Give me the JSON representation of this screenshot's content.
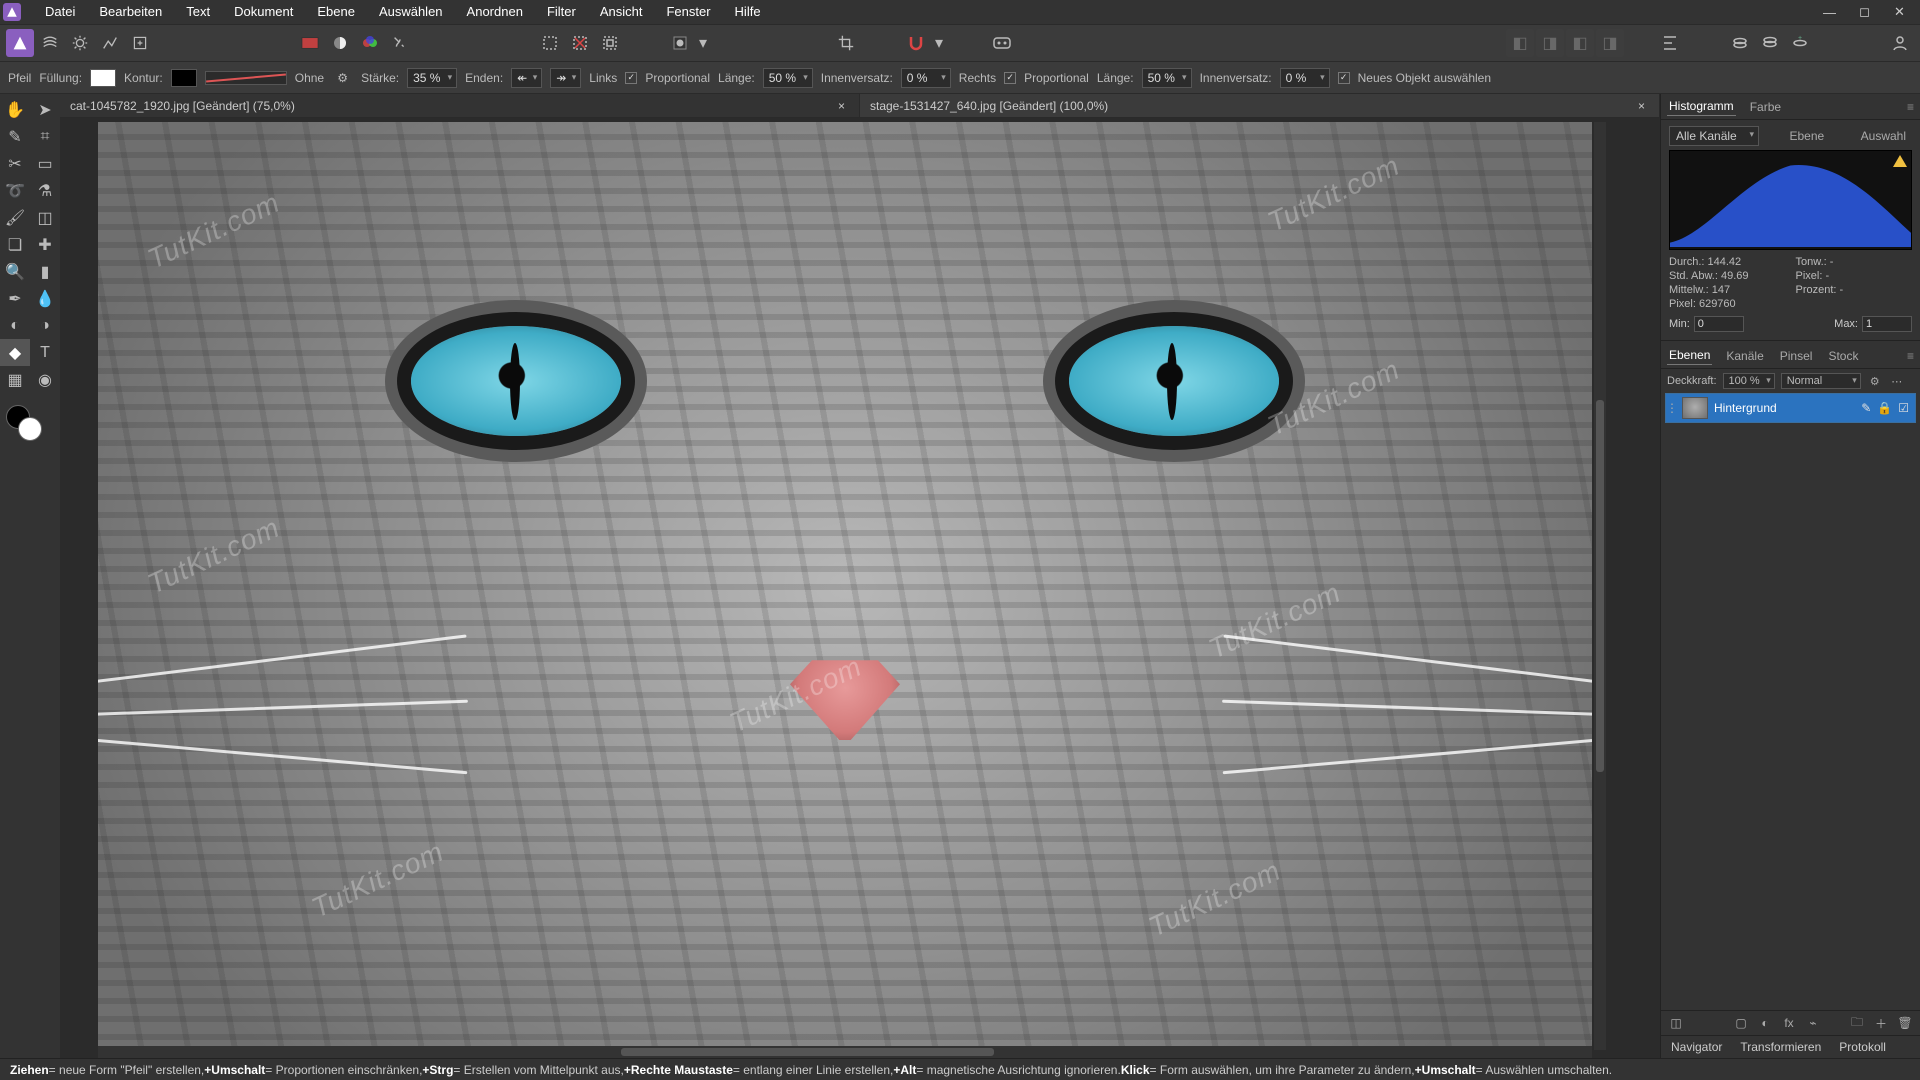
{
  "menu": [
    "Datei",
    "Bearbeiten",
    "Text",
    "Dokument",
    "Ebene",
    "Auswählen",
    "Anordnen",
    "Filter",
    "Ansicht",
    "Fenster",
    "Hilfe"
  ],
  "context": {
    "tool": "Pfeil",
    "fill_label": "Füllung:",
    "fill_color": "#ffffff",
    "stroke_label": "Kontur:",
    "stroke_color": "#000000",
    "style_label": "Ohne",
    "strength_label": "Stärke:",
    "strength_value": "35 %",
    "ends_label": "Enden:",
    "links_label": "Links",
    "proportional_label": "Proportional",
    "length_label": "Länge:",
    "length_left": "50 %",
    "inset_label": "Innenversatz:",
    "inset_left": "0 %",
    "rechts_label": "Rechts",
    "length_right": "50 %",
    "inset_right": "0 %",
    "new_obj_label": "Neues Objekt auswählen"
  },
  "tabs": [
    {
      "title": "cat-1045782_1920.jpg [Geändert] (75,0%)",
      "active": true
    },
    {
      "title": "stage-1531427_640.jpg [Geändert] (100,0%)",
      "active": false
    }
  ],
  "watermark": "TutKit.com",
  "right": {
    "tab_hist": "Histogramm",
    "tab_farbe": "Farbe",
    "channel": "Alle Kanäle",
    "btn_ebene": "Ebene",
    "btn_auswahl": "Auswahl",
    "stats": {
      "durch": "Durch.: 144.42",
      "abw": "Std. Abw.: 49.69",
      "mittel": "Mittelw.: 147",
      "pixel": "Pixel: 629760",
      "tonw": "Tonw.: -",
      "pix": "Pixel: -",
      "proz": "Prozent: -"
    },
    "min_label": "Min:",
    "min_value": "0",
    "max_label": "Max:",
    "max_value": "1",
    "tab_ebenen": "Ebenen",
    "tab_kanaele": "Kanäle",
    "tab_pinsel": "Pinsel",
    "tab_stock": "Stock",
    "opacity_label": "Deckkraft:",
    "opacity_value": "100 %",
    "blend_value": "Normal",
    "layer_name": "Hintergrund",
    "bottom_tabs": [
      "Navigator",
      "Transformieren",
      "Protokoll"
    ]
  },
  "status": {
    "t1": "Ziehen",
    "d1": " = neue Form \"Pfeil\" erstellen, ",
    "t2": "+Umschalt",
    "d2": " = Proportionen einschränken, ",
    "t3": "+Strg",
    "d3": " = Erstellen vom Mittelpunkt aus, ",
    "t4": "+Rechte Maustaste",
    "d4": " = entlang einer Linie erstellen, ",
    "t5": "+Alt",
    "d5": " = magnetische Ausrichtung ignorieren. ",
    "t6": "Klick",
    "d6": " = Form auswählen, um ihre Parameter zu ändern, ",
    "t7": "+Umschalt",
    "d7": " = Auswählen umschalten."
  }
}
